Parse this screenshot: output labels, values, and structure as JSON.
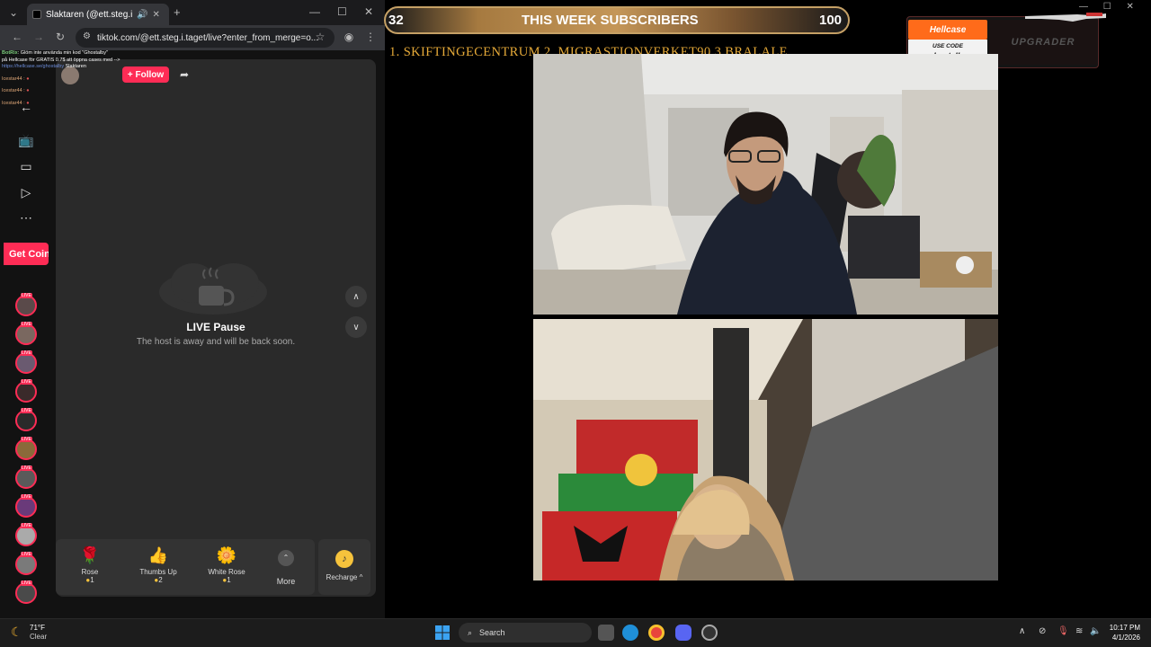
{
  "browser": {
    "tab_title": "Slaktaren (@ett.steg.i.taget)",
    "url": "tiktok.com/@ett.steg.i.taget/live?enter_from_merge=o...",
    "new_tab": "+",
    "minimize": "—",
    "maximize": "☐",
    "close": "✕"
  },
  "chat": {
    "line1_user": "BotRix",
    "line1_text": ": Glöm inte använda min kod \"Ghostalby\"",
    "line2_text": "på Hellcase för GRATIS 0.7$ att öppna cases med -->",
    "line3_link": "https://hellcase.se/ghostalby",
    "line3_name": "Slaktaren",
    "line4_user": "Icestar44 :",
    "line5_user": "Icestar44 :",
    "line6_user": "Icestar44 :"
  },
  "tiktok": {
    "follow_label": "+ Follow",
    "get_coins": "Get Coins",
    "pause_title": "LIVE Pause",
    "pause_sub": "The host is away and will be back soon.",
    "gifts": [
      {
        "name": "Rose",
        "price": "1",
        "icon": "🌹"
      },
      {
        "name": "Thumbs Up",
        "price": "2",
        "icon": "👍"
      },
      {
        "name": "White Rose",
        "price": "1",
        "icon": "🌼"
      }
    ],
    "more_label": "More",
    "recharge_label": "Recharge ^"
  },
  "overlay": {
    "sub_count": "32",
    "sub_title": "THIS WEEK SUBSCRIBERS",
    "sub_goal": "100",
    "top_subs": "1. SKIFTINGECENTRUM  2. MIGRASTIONVERKET90 3.BRALALE",
    "sponsor_brand": "Hellcase",
    "sponsor_use_code": "USE CODE",
    "sponsor_code": "ghostalby",
    "sponsor_partner": "UPGRADER"
  },
  "taskbar": {
    "temp": "71°F",
    "condition": "Clear",
    "search": "Search",
    "time": "10:17 PM",
    "date": "4/1/2026"
  },
  "colors": {
    "tiktok_red": "#fe2c55",
    "gold": "#e5a938",
    "hellcase_orange": "#ff6b1a"
  }
}
